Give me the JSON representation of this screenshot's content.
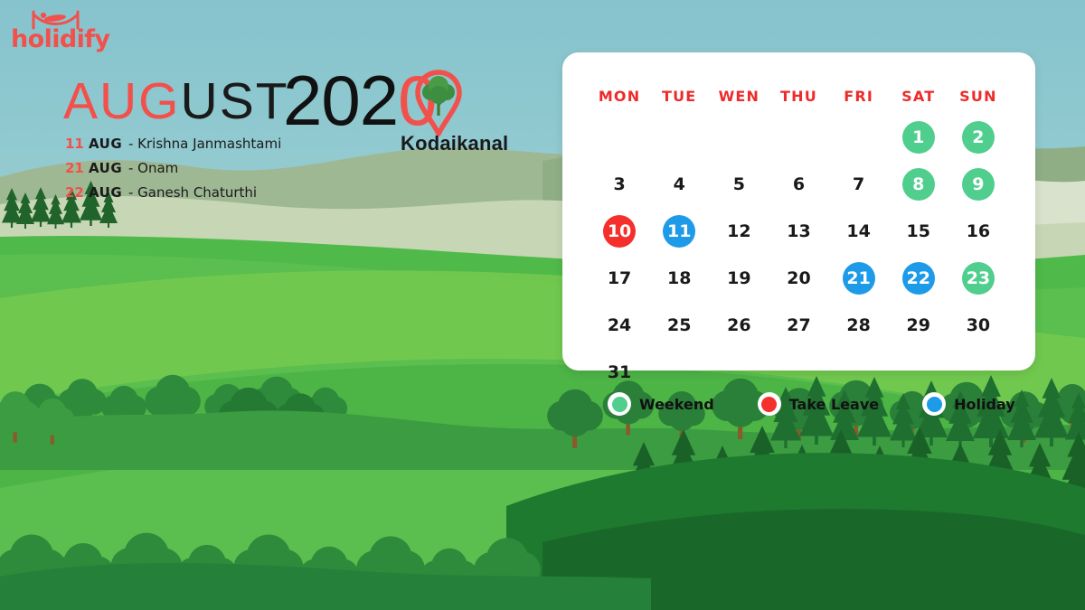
{
  "brand": {
    "name": "holidify",
    "logo_icon": "hammock-icon",
    "color": "#F2504B"
  },
  "headline": {
    "month_highlight": "AUG",
    "month_rest": "UST",
    "year_dark": "202",
    "year_highlight": "0",
    "pin_icon": "map-pin-tree-icon",
    "place": "Kodaikanal"
  },
  "events": [
    {
      "day": "11",
      "month": "AUG",
      "sep": "-",
      "name": "Krishna Janmashtami"
    },
    {
      "day": "21",
      "month": "AUG",
      "sep": "-",
      "name": "Onam"
    },
    {
      "day": "22",
      "month": "AUG",
      "sep": "-",
      "name": "Ganesh Chaturthi"
    }
  ],
  "calendar": {
    "weekdays": [
      "MON",
      "TUE",
      "WEN",
      "THU",
      "FRI",
      "SAT",
      "SUN"
    ],
    "cells": [
      {
        "label": "",
        "state": "empty"
      },
      {
        "label": "",
        "state": "empty"
      },
      {
        "label": "",
        "state": "empty"
      },
      {
        "label": "",
        "state": "empty"
      },
      {
        "label": "",
        "state": "empty"
      },
      {
        "label": "1",
        "state": "weekend"
      },
      {
        "label": "2",
        "state": "weekend"
      },
      {
        "label": "3",
        "state": "normal"
      },
      {
        "label": "4",
        "state": "normal"
      },
      {
        "label": "5",
        "state": "normal"
      },
      {
        "label": "6",
        "state": "normal"
      },
      {
        "label": "7",
        "state": "normal"
      },
      {
        "label": "8",
        "state": "weekend"
      },
      {
        "label": "9",
        "state": "weekend"
      },
      {
        "label": "10",
        "state": "leave"
      },
      {
        "label": "11",
        "state": "holiday"
      },
      {
        "label": "12",
        "state": "normal"
      },
      {
        "label": "13",
        "state": "normal"
      },
      {
        "label": "14",
        "state": "normal"
      },
      {
        "label": "15",
        "state": "normal"
      },
      {
        "label": "16",
        "state": "normal"
      },
      {
        "label": "17",
        "state": "normal"
      },
      {
        "label": "18",
        "state": "normal"
      },
      {
        "label": "19",
        "state": "normal"
      },
      {
        "label": "20",
        "state": "normal"
      },
      {
        "label": "21",
        "state": "holiday"
      },
      {
        "label": "22",
        "state": "holiday"
      },
      {
        "label": "23",
        "state": "weekend"
      },
      {
        "label": "24",
        "state": "normal"
      },
      {
        "label": "25",
        "state": "normal"
      },
      {
        "label": "26",
        "state": "normal"
      },
      {
        "label": "27",
        "state": "normal"
      },
      {
        "label": "28",
        "state": "normal"
      },
      {
        "label": "29",
        "state": "normal"
      },
      {
        "label": "30",
        "state": "normal"
      },
      {
        "label": "31",
        "state": "normal"
      },
      {
        "label": "",
        "state": "empty"
      },
      {
        "label": "",
        "state": "empty"
      },
      {
        "label": "",
        "state": "empty"
      },
      {
        "label": "",
        "state": "empty"
      },
      {
        "label": "",
        "state": "empty"
      },
      {
        "label": "",
        "state": "empty"
      }
    ]
  },
  "legend": [
    {
      "label": "Weekend",
      "color": "#4FCE8E"
    },
    {
      "label": "Take Leave",
      "color": "#F5302C"
    },
    {
      "label": "Holiday",
      "color": "#1E9BE8"
    }
  ],
  "palette": {
    "sky": "#8CC6CE",
    "weekend": "#4FCE8E",
    "take_leave": "#F5302C",
    "holiday": "#1E9BE8",
    "weekday_header": "#EE2B2B",
    "card": "#FFFFFF"
  }
}
